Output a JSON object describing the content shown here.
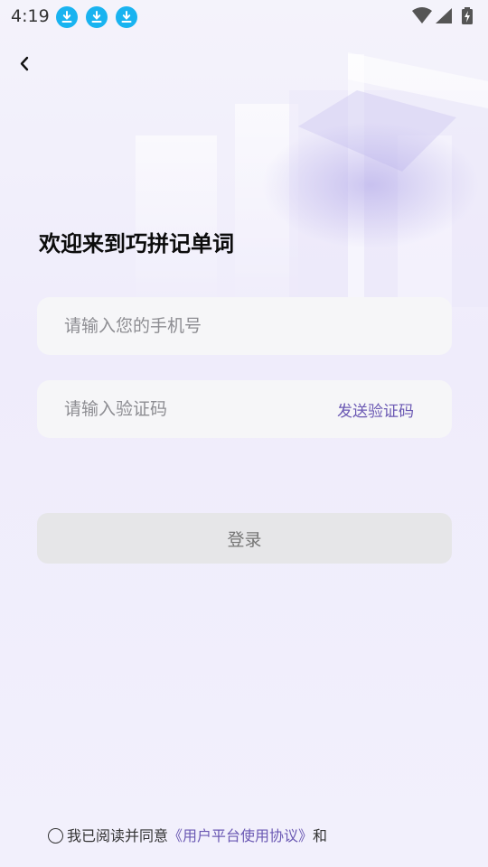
{
  "status_bar": {
    "time": "4:19",
    "download_icons": [
      "download-icon",
      "download-icon",
      "download-icon"
    ],
    "icons": [
      "wifi-icon",
      "cell-signal-icon",
      "battery-charging-icon"
    ],
    "accent_color": "#19b3f0"
  },
  "nav": {
    "back_icon": "chevron-left-icon"
  },
  "welcome_title": "欢迎来到巧拼记单词",
  "phone_field": {
    "placeholder": "请输入您的手机号",
    "value": ""
  },
  "code_field": {
    "placeholder": "请输入验证码",
    "value": "",
    "send_label": "发送验证码"
  },
  "login_button": {
    "label": "登录"
  },
  "agreement": {
    "checked": false,
    "prefix": "我已阅读并同意",
    "link_label": "《用户平台使用协议》",
    "suffix": "和"
  },
  "colors": {
    "link": "#6a58b3",
    "field_bg": "#f6f6f8",
    "button_bg": "#e6e6e8",
    "background": "#efecfb"
  }
}
